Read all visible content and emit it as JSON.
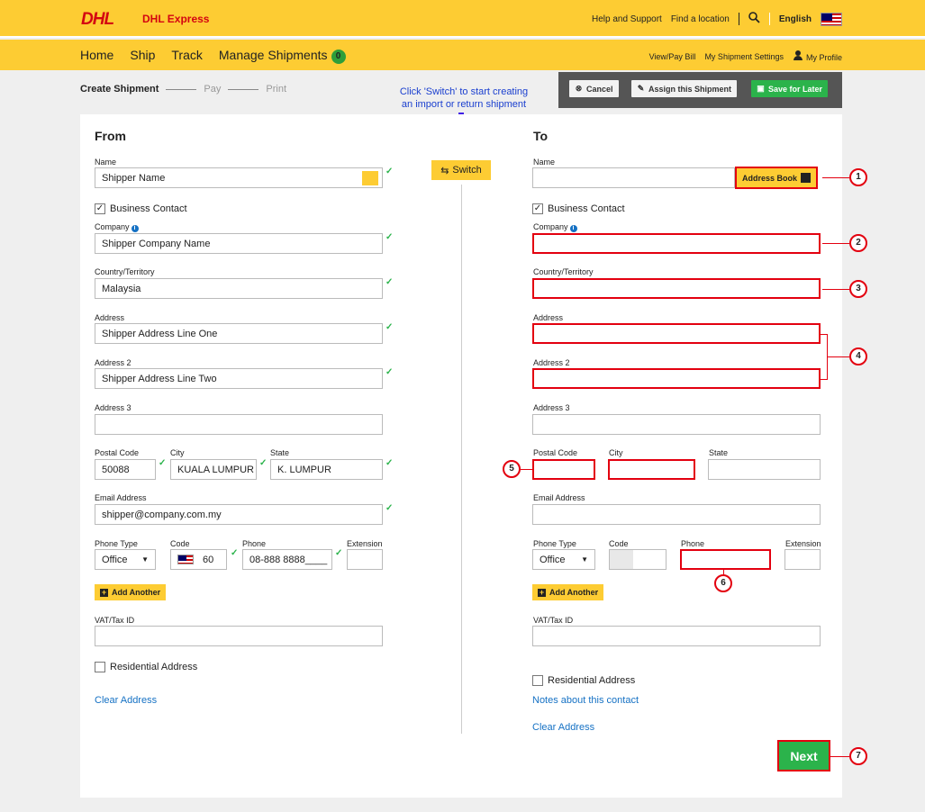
{
  "header": {
    "logo_text": "DHL",
    "brand": "DHL Express",
    "help": "Help and Support",
    "find_location": "Find a location",
    "language": "English"
  },
  "nav": {
    "home": "Home",
    "ship": "Ship",
    "track": "Track",
    "manage": "Manage Shipments",
    "manage_count": "0",
    "view_pay": "View/Pay Bill",
    "settings": "My Shipment Settings",
    "profile": "My Profile"
  },
  "steps": {
    "create": "Create Shipment",
    "pay": "Pay",
    "print": "Print"
  },
  "actions": {
    "cancel": "Cancel",
    "assign": "Assign this Shipment",
    "save_later": "Save for Later"
  },
  "hint": {
    "line1": "Click 'Switch' to start creating",
    "line2": "an import or return shipment"
  },
  "switch_label": "Switch",
  "from": {
    "title": "From",
    "name_label": "Name",
    "name_value": "Shipper Name",
    "business_contact": "Business Contact",
    "company_label": "Company",
    "company_value": "Shipper Company Name",
    "country_label": "Country/Territory",
    "country_value": "Malaysia",
    "address_label": "Address",
    "address_value": "Shipper Address Line One",
    "address2_label": "Address 2",
    "address2_value": "Shipper Address Line Two",
    "address3_label": "Address 3",
    "address3_value": "",
    "postal_label": "Postal Code",
    "postal_value": "50088",
    "city_label": "City",
    "city_value": "KUALA LUMPUR",
    "state_label": "State",
    "state_value": "K. LUMPUR",
    "email_label": "Email Address",
    "email_value": "shipper@company.com.my",
    "phone_type_label": "Phone Type",
    "phone_type_value": "Office",
    "code_label": "Code",
    "code_value": "60",
    "phone_label": "Phone",
    "phone_value": "08-888 8888____",
    "extension_label": "Extension",
    "extension_value": "",
    "add_another": "Add Another",
    "vat_label": "VAT/Tax ID",
    "vat_value": "",
    "residential": "Residential Address",
    "clear": "Clear Address"
  },
  "to": {
    "title": "To",
    "name_label": "Name",
    "name_value": "",
    "address_book": "Address Book",
    "business_contact": "Business Contact",
    "company_label": "Company",
    "country_label": "Country/Territory",
    "address_label": "Address",
    "address2_label": "Address 2",
    "address3_label": "Address 3",
    "postal_label": "Postal Code",
    "city_label": "City",
    "state_label": "State",
    "email_label": "Email Address",
    "phone_type_label": "Phone Type",
    "phone_type_value": "Office",
    "code_label": "Code",
    "phone_label": "Phone",
    "extension_label": "Extension",
    "add_another": "Add Another",
    "vat_label": "VAT/Tax ID",
    "residential": "Residential Address",
    "notes": "Notes about this contact",
    "clear": "Clear Address"
  },
  "callouts": [
    "1",
    "2",
    "3",
    "4",
    "5",
    "6",
    "7"
  ],
  "next": "Next",
  "colors": {
    "dhl_yellow": "#fdcc33",
    "dhl_red": "#d40511",
    "green": "#2bb34b",
    "link": "#1571c4"
  }
}
